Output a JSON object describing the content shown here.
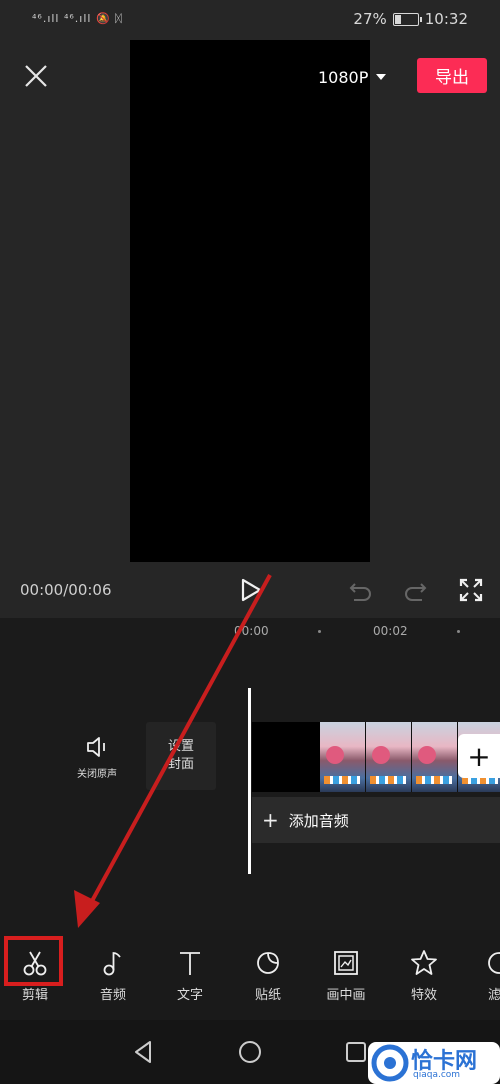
{
  "status_bar": {
    "signal_text": "⁴⁶.ıll ⁴⁶.ıll",
    "battery_percent": "27%",
    "time": "10:32"
  },
  "header": {
    "resolution": "1080P",
    "export_label": "导出"
  },
  "player": {
    "timecode": "00:00/00:06"
  },
  "timeline": {
    "ticks": [
      "00:00",
      "00:02"
    ],
    "mute_label": "关闭原声",
    "cover_label_line1": "设置",
    "cover_label_line2": "封面",
    "add_audio_label": "添加音频"
  },
  "toolbar": {
    "items": [
      {
        "label": "剪辑",
        "icon": "scissors-icon"
      },
      {
        "label": "音频",
        "icon": "music-note-icon"
      },
      {
        "label": "文字",
        "icon": "text-icon"
      },
      {
        "label": "贴纸",
        "icon": "sticker-icon"
      },
      {
        "label": "画中画",
        "icon": "picture-in-picture-icon"
      },
      {
        "label": "特效",
        "icon": "star-icon"
      },
      {
        "label": "滤",
        "icon": "filter-icon"
      }
    ]
  },
  "watermark": {
    "name": "恰卡网",
    "url": "qiaqa.com"
  },
  "colors": {
    "accent": "#fc2c55",
    "annotation": "#d81e1e",
    "watermark": "#2b72d4"
  }
}
